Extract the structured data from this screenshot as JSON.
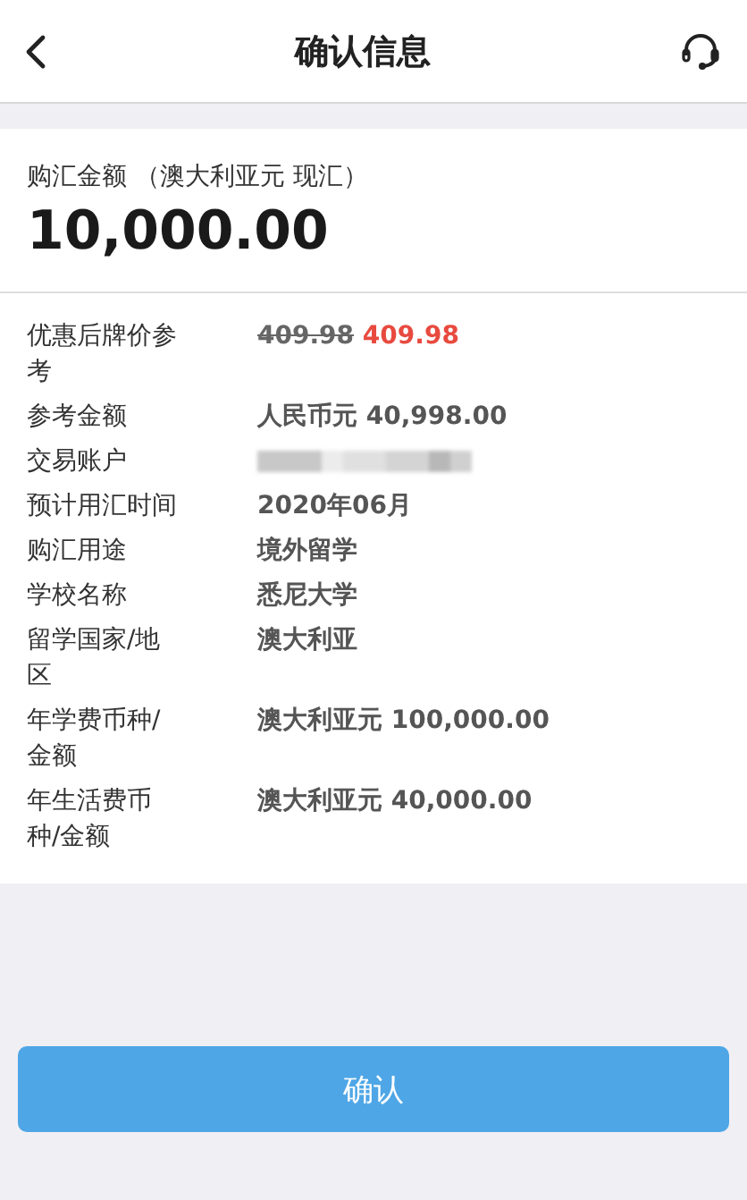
{
  "header": {
    "title": "确认信息"
  },
  "amount": {
    "label": "购汇金额 （澳大利亚元 现汇）",
    "value": "10,000.00"
  },
  "details": [
    {
      "label": "优惠后牌价参考",
      "kind": "price",
      "old": "409.98",
      "new": "409.98"
    },
    {
      "label": "参考金额",
      "kind": "text",
      "value": "人民币元 40,998.00"
    },
    {
      "label": "交易账户",
      "kind": "blurred"
    },
    {
      "label": "预计用汇时间",
      "kind": "text",
      "value": "2020年06月"
    },
    {
      "label": "购汇用途",
      "kind": "text",
      "value": "境外留学"
    },
    {
      "label": "学校名称",
      "kind": "text",
      "value": "悉尼大学"
    },
    {
      "label": "留学国家/地区",
      "kind": "text",
      "value": "澳大利亚"
    },
    {
      "label": "年学费币种/金额",
      "kind": "text",
      "value": "澳大利亚元 100,000.00"
    },
    {
      "label": "年生活费币种/金额",
      "kind": "text",
      "value": "澳大利亚元 40,000.00"
    }
  ],
  "confirm_button": "确认"
}
